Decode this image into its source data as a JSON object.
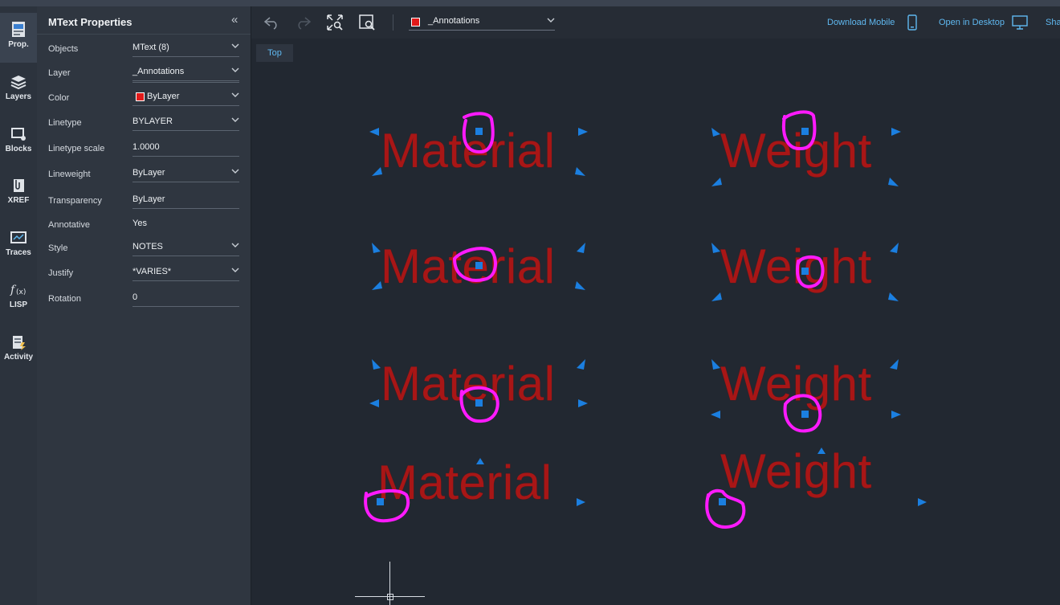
{
  "rail": {
    "items": [
      {
        "label": "Prop.",
        "icon": "properties-icon"
      },
      {
        "label": "Layers",
        "icon": "layers-icon"
      },
      {
        "label": "Blocks",
        "icon": "blocks-icon"
      },
      {
        "label": "XREF",
        "icon": "xref-icon"
      },
      {
        "label": "Traces",
        "icon": "traces-icon"
      },
      {
        "label": "LISP",
        "icon": "lisp-icon"
      },
      {
        "label": "Activity",
        "icon": "activity-icon"
      }
    ]
  },
  "panel": {
    "title": "MText Properties",
    "collapse_icon": "«",
    "rows": [
      {
        "label": "Objects",
        "value": "MText (8)"
      },
      {
        "label": "Layer",
        "value": "_Annotations"
      },
      {
        "label": "Color",
        "value": "ByLayer"
      },
      {
        "label": "Linetype",
        "value": "BYLAYER"
      },
      {
        "label": "Linetype scale",
        "value": "1.0000"
      },
      {
        "label": "Lineweight",
        "value": "ByLayer"
      },
      {
        "label": "Transparency",
        "value": "ByLayer"
      },
      {
        "label": "Annotative",
        "value": "Yes"
      },
      {
        "label": "Style",
        "value": "NOTES"
      },
      {
        "label": "Justify",
        "value": "*VARIES*"
      },
      {
        "label": "Rotation",
        "value": "0"
      }
    ]
  },
  "toolbar": {
    "layer_value": "_Annotations",
    "download_mobile": "Download Mobile",
    "open_desktop": "Open in Desktop",
    "share": "Sha"
  },
  "canvas": {
    "view_label": "Top",
    "texts": [
      "Material",
      "Weight",
      "Material",
      "Weight",
      "Material",
      "Weight",
      "Material",
      "Weight"
    ]
  },
  "colors": {
    "accent": "#5fb8f0",
    "grip": "#1b7fe0",
    "text": "#a81616",
    "highlight": "#ff1aff",
    "layer_color": "#e11a1a"
  }
}
